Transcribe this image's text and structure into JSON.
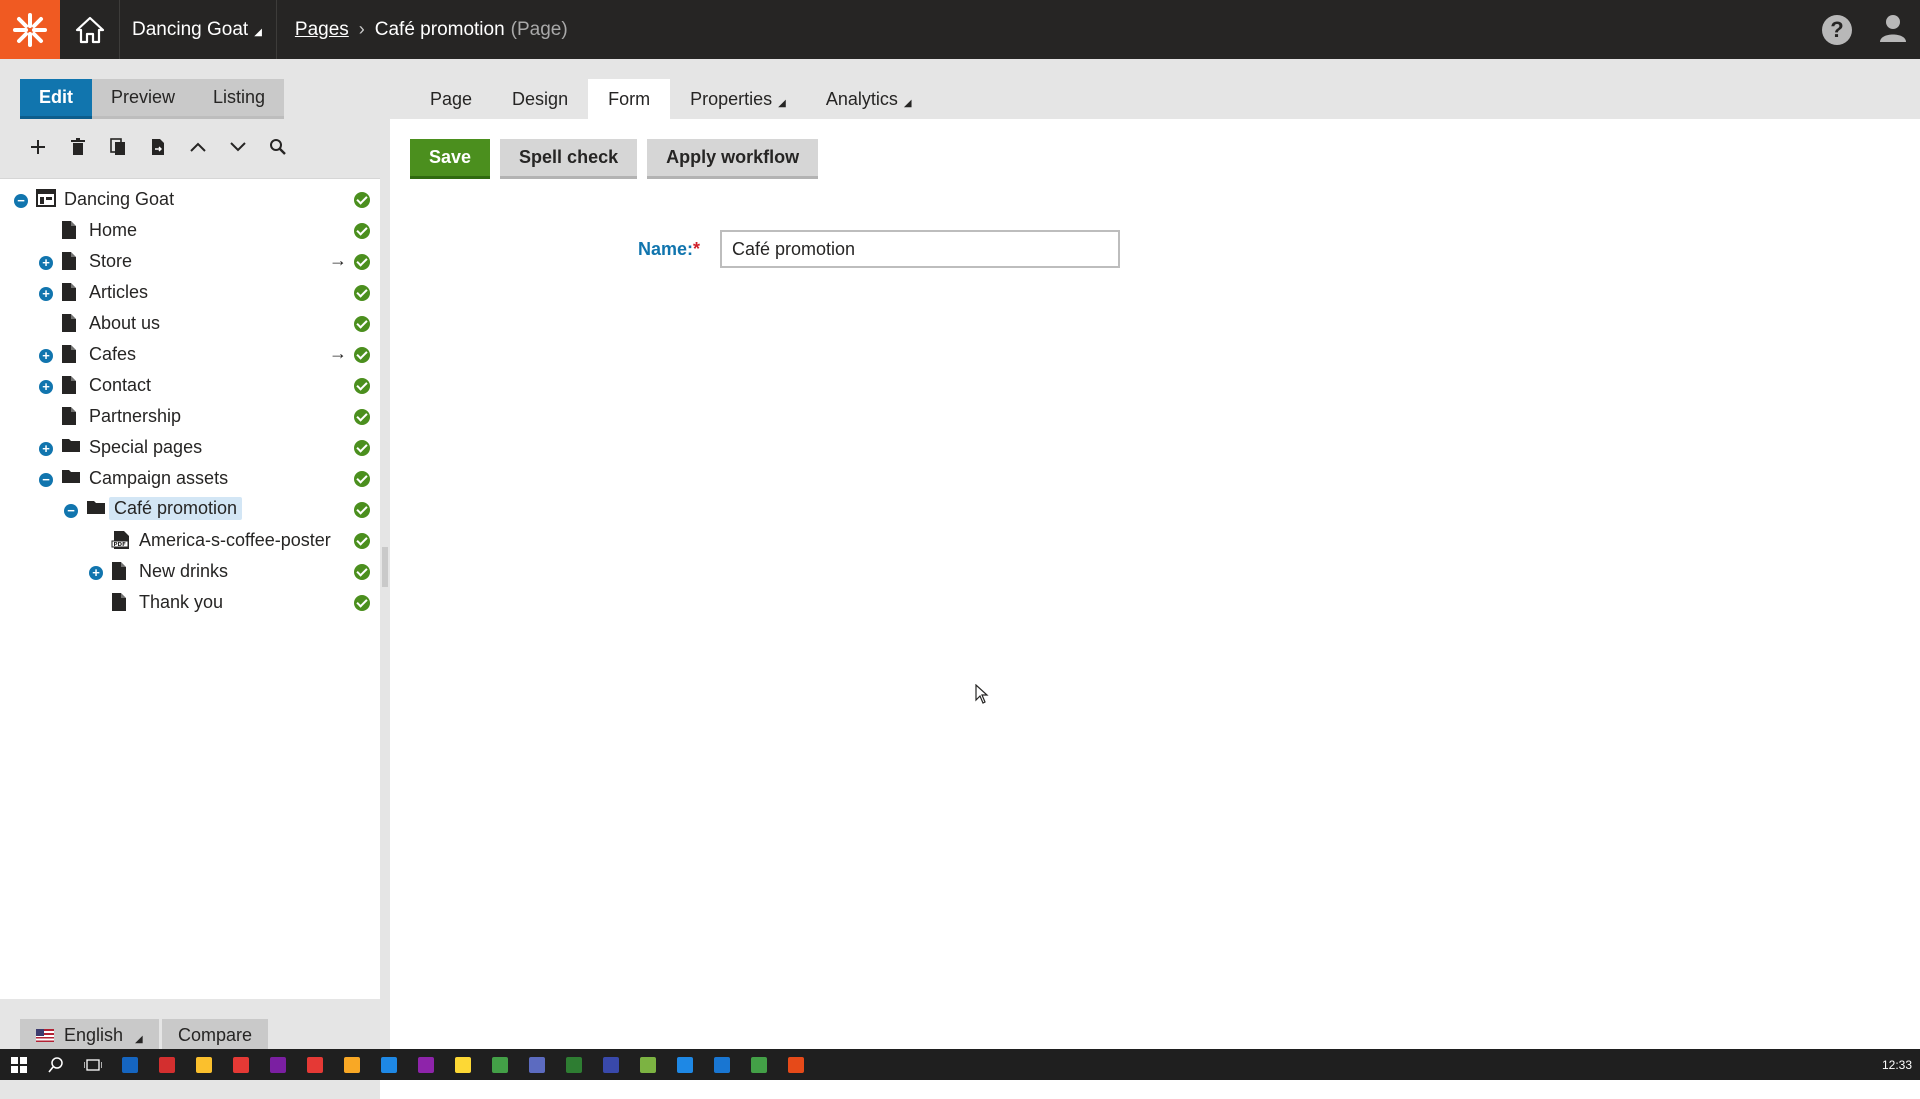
{
  "header": {
    "site_name": "Dancing Goat",
    "breadcrumb_link": "Pages",
    "breadcrumb_current": "Café promotion",
    "breadcrumb_type": "(Page)"
  },
  "left": {
    "modes": [
      "Edit",
      "Preview",
      "Listing"
    ],
    "tree": [
      {
        "label": "Dancing Goat",
        "level": 0,
        "toggle": "-",
        "icon": "site",
        "arrow": false
      },
      {
        "label": "Home",
        "level": 1,
        "toggle": "",
        "icon": "page",
        "arrow": false
      },
      {
        "label": "Store",
        "level": 1,
        "toggle": "+",
        "icon": "page",
        "arrow": true
      },
      {
        "label": "Articles",
        "level": 1,
        "toggle": "+",
        "icon": "page",
        "arrow": false
      },
      {
        "label": "About us",
        "level": 1,
        "toggle": "",
        "icon": "page",
        "arrow": false
      },
      {
        "label": "Cafes",
        "level": 1,
        "toggle": "+",
        "icon": "page",
        "arrow": true
      },
      {
        "label": "Contact",
        "level": 1,
        "toggle": "+",
        "icon": "page",
        "arrow": false
      },
      {
        "label": "Partnership",
        "level": 1,
        "toggle": "",
        "icon": "page",
        "arrow": false
      },
      {
        "label": "Special pages",
        "level": 1,
        "toggle": "+",
        "icon": "folder",
        "arrow": false
      },
      {
        "label": "Campaign assets",
        "level": 1,
        "toggle": "-",
        "icon": "folder",
        "arrow": false
      },
      {
        "label": "Café promotion",
        "level": 2,
        "toggle": "-",
        "icon": "folder",
        "arrow": false,
        "selected": true
      },
      {
        "label": "America-s-coffee-poster",
        "level": 3,
        "toggle": "",
        "icon": "pdf",
        "arrow": false
      },
      {
        "label": "New drinks",
        "level": 3,
        "toggle": "+",
        "icon": "page",
        "arrow": false
      },
      {
        "label": "Thank you",
        "level": 3,
        "toggle": "",
        "icon": "page",
        "arrow": false
      }
    ],
    "language": "English",
    "compare": "Compare"
  },
  "tabs": [
    {
      "label": "Page",
      "active": false,
      "caret": false
    },
    {
      "label": "Design",
      "active": false,
      "caret": false
    },
    {
      "label": "Form",
      "active": true,
      "caret": false
    },
    {
      "label": "Properties",
      "active": false,
      "caret": true
    },
    {
      "label": "Analytics",
      "active": false,
      "caret": true
    }
  ],
  "actions": {
    "save": "Save",
    "spell_check": "Spell check",
    "apply_workflow": "Apply workflow"
  },
  "form": {
    "name_label": "Name:",
    "required_mark": "*",
    "name_value": "Café promotion"
  },
  "taskbar": {
    "time": "12:33",
    "app_colors": [
      "#1565c0",
      "#d32f2f",
      "#fbc02d",
      "#e53935",
      "#7b1fa2",
      "#e53935",
      "#f9a825",
      "#1e88e5",
      "#8e24aa",
      "#fdd835",
      "#43a047",
      "#5c6bc0",
      "#2e7d32",
      "#3949ab",
      "#7cb342",
      "#1e88e5",
      "#1976d2",
      "#43a047",
      "#e64a19"
    ]
  },
  "colors": {
    "accent": "#1175ae",
    "brand": "#f05a22",
    "success": "#4b8f1e",
    "header_bg": "#262524"
  }
}
